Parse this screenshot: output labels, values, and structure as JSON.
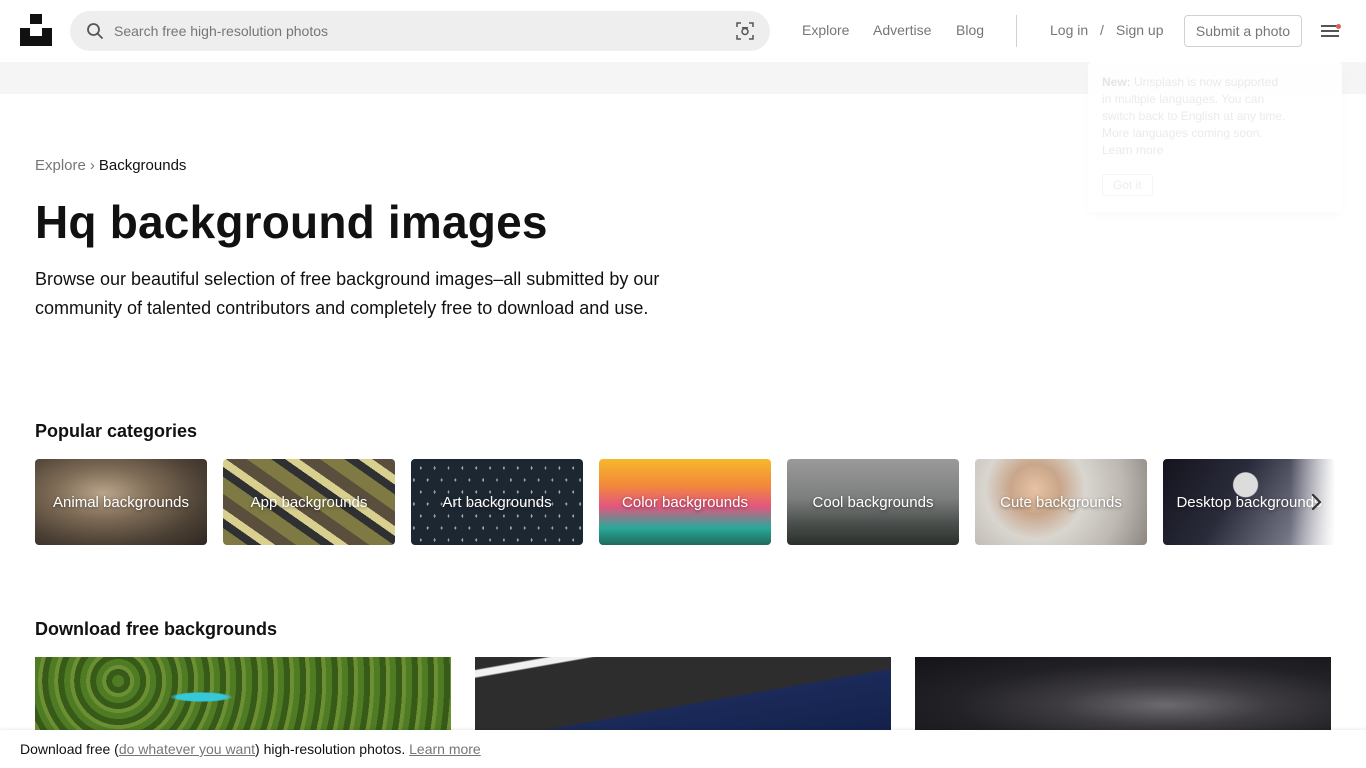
{
  "header": {
    "search_placeholder": "Search free high-resolution photos",
    "nav": {
      "explore": "Explore",
      "advertise": "Advertise",
      "blog": "Blog",
      "login": "Log in",
      "slash": "/",
      "signup": "Sign up",
      "submit": "Submit a photo"
    }
  },
  "toast": {
    "prefix": "New:",
    "text": "Unsplash is now supported in multiple languages. You can switch back to English at any time. More languages coming soon.",
    "link": "Learn more",
    "button": "Got it"
  },
  "breadcrumb": {
    "parent": "Explore",
    "separator": "›",
    "current": "Backgrounds"
  },
  "main": {
    "title": "Hq background images",
    "description": "Browse our beautiful selection of free background images–all submitted by our community of talented contributors and completely free to download and use."
  },
  "categories": {
    "title": "Popular categories",
    "items": [
      {
        "label": "Animal backgrounds"
      },
      {
        "label": "App backgrounds"
      },
      {
        "label": "Art backgrounds"
      },
      {
        "label": "Color backgrounds"
      },
      {
        "label": "Cool backgrounds"
      },
      {
        "label": "Cute backgrounds"
      },
      {
        "label": "Desktop backgrounds"
      }
    ]
  },
  "downloads": {
    "title": "Download free backgrounds"
  },
  "footer": {
    "prefix": "Download free (",
    "link1": "do whatever you want",
    "middle": ") high-resolution photos.",
    "link2": "Learn more"
  },
  "colors": {
    "text": "#111111",
    "muted": "#767676",
    "search_bg": "#eeeeee",
    "band": "#f5f5f5"
  }
}
